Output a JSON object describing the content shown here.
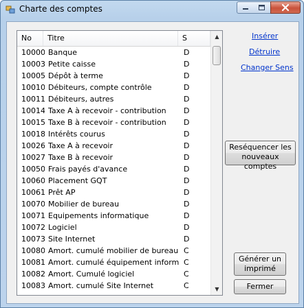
{
  "window": {
    "title": "Charte des comptes",
    "icons": {
      "app": "app-icon",
      "minimize": "minimize-icon",
      "maximize": "maximize-icon",
      "close": "close-icon"
    }
  },
  "list": {
    "headers": {
      "no": "No",
      "titre": "Titre",
      "s": "S"
    },
    "rows": [
      {
        "no": "10000",
        "titre": "Banque",
        "s": "D"
      },
      {
        "no": "10003",
        "titre": "Petite caisse",
        "s": "D"
      },
      {
        "no": "10005",
        "titre": "Dépôt à terme",
        "s": "D"
      },
      {
        "no": "10010",
        "titre": "Débiteurs, compte contrôle",
        "s": "D"
      },
      {
        "no": "10011",
        "titre": "Débiteurs, autres",
        "s": "D"
      },
      {
        "no": "10014",
        "titre": "Taxe A à recevoir - contribution",
        "s": "D"
      },
      {
        "no": "10015",
        "titre": "Taxe B à recevoir - contribution",
        "s": "D"
      },
      {
        "no": "10018",
        "titre": "Intérêts courus",
        "s": "D"
      },
      {
        "no": "10026",
        "titre": "Taxe A à recevoir",
        "s": "D"
      },
      {
        "no": "10027",
        "titre": "Taxe B à recevoir",
        "s": "D"
      },
      {
        "no": "10050",
        "titre": "Frais payés d'avance",
        "s": "D"
      },
      {
        "no": "10060",
        "titre": "Placement GQT",
        "s": "D"
      },
      {
        "no": "10061",
        "titre": "Prêt AP",
        "s": "D"
      },
      {
        "no": "10070",
        "titre": "Mobilier de bureau",
        "s": "D"
      },
      {
        "no": "10071",
        "titre": "Equipements informatique",
        "s": "D"
      },
      {
        "no": "10072",
        "titre": "Logiciel",
        "s": "D"
      },
      {
        "no": "10073",
        "titre": "Site Internet",
        "s": "D"
      },
      {
        "no": "10080",
        "titre": "Amort. cumulé mobilier de bureau",
        "s": "C"
      },
      {
        "no": "10081",
        "titre": "Amort. cumulé équipement informatique",
        "s": "C"
      },
      {
        "no": "10082",
        "titre": "Amort. Cumulé logiciel",
        "s": "C"
      },
      {
        "no": "10083",
        "titre": "Amort. cumulé Site Internet",
        "s": "C"
      }
    ]
  },
  "links": {
    "inserer": "Insérer",
    "detruire": "Détruire",
    "changer_sens": "Changer Sens"
  },
  "buttons": {
    "resequencer_line1": "Reséquencer les",
    "resequencer_line2": "nouveaux comptes",
    "generer_line1": "Générer un",
    "generer_line2": "imprimé",
    "fermer": "Fermer"
  }
}
